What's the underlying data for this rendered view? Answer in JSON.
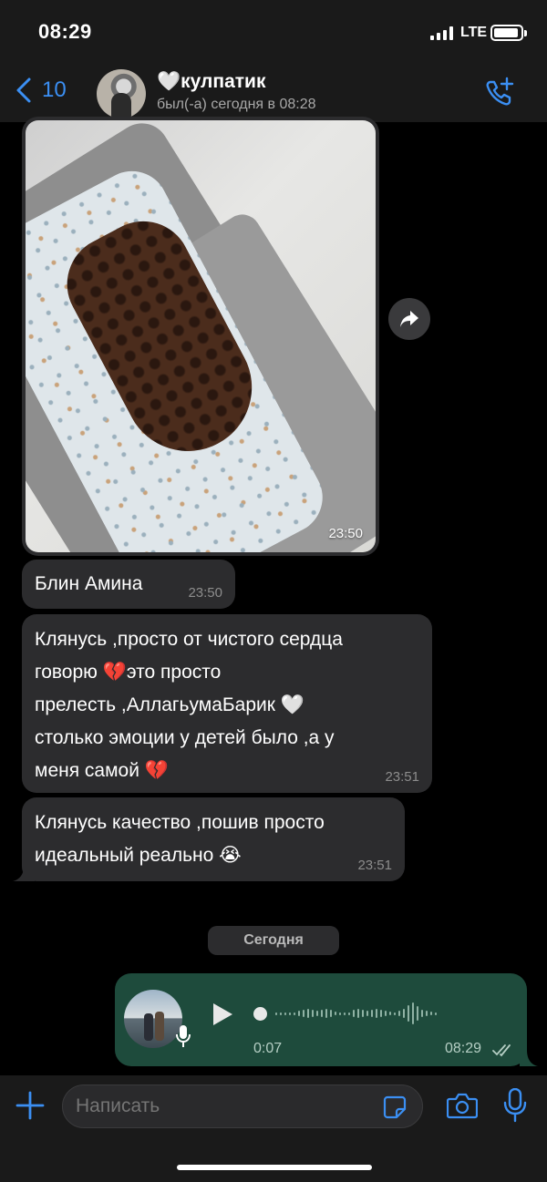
{
  "status_bar": {
    "time": "08:29",
    "network": "LTE"
  },
  "header": {
    "back_count": "10",
    "contact_name": "🤍кулпатик",
    "contact_status": "был(-а) сегодня в 08:28"
  },
  "messages": [
    {
      "type": "photo",
      "time": "23:50"
    },
    {
      "type": "text",
      "text": "Блин Амина",
      "time": "23:50"
    },
    {
      "type": "text",
      "lines": [
        "Клянусь ,просто от чистого сердца",
        "говорю 💔это просто",
        "прелесть ,АллагьумаБарик 🤍",
        "столько эмоции у детей было ,а у",
        "меня самой 💔"
      ],
      "time": "23:51"
    },
    {
      "type": "text",
      "lines": [
        "Клянусь качество ,пошив просто",
        "идеальный реально 😭"
      ],
      "time": "23:51"
    }
  ],
  "date_separator": "Сегодня",
  "voice_message": {
    "duration": "0:07",
    "time": "08:29"
  },
  "composer": {
    "placeholder": "Написать"
  },
  "colors": {
    "accent": "#3b8ff3",
    "incoming_bubble": "#2c2c2e",
    "outgoing_bubble": "#1e4b3c"
  }
}
